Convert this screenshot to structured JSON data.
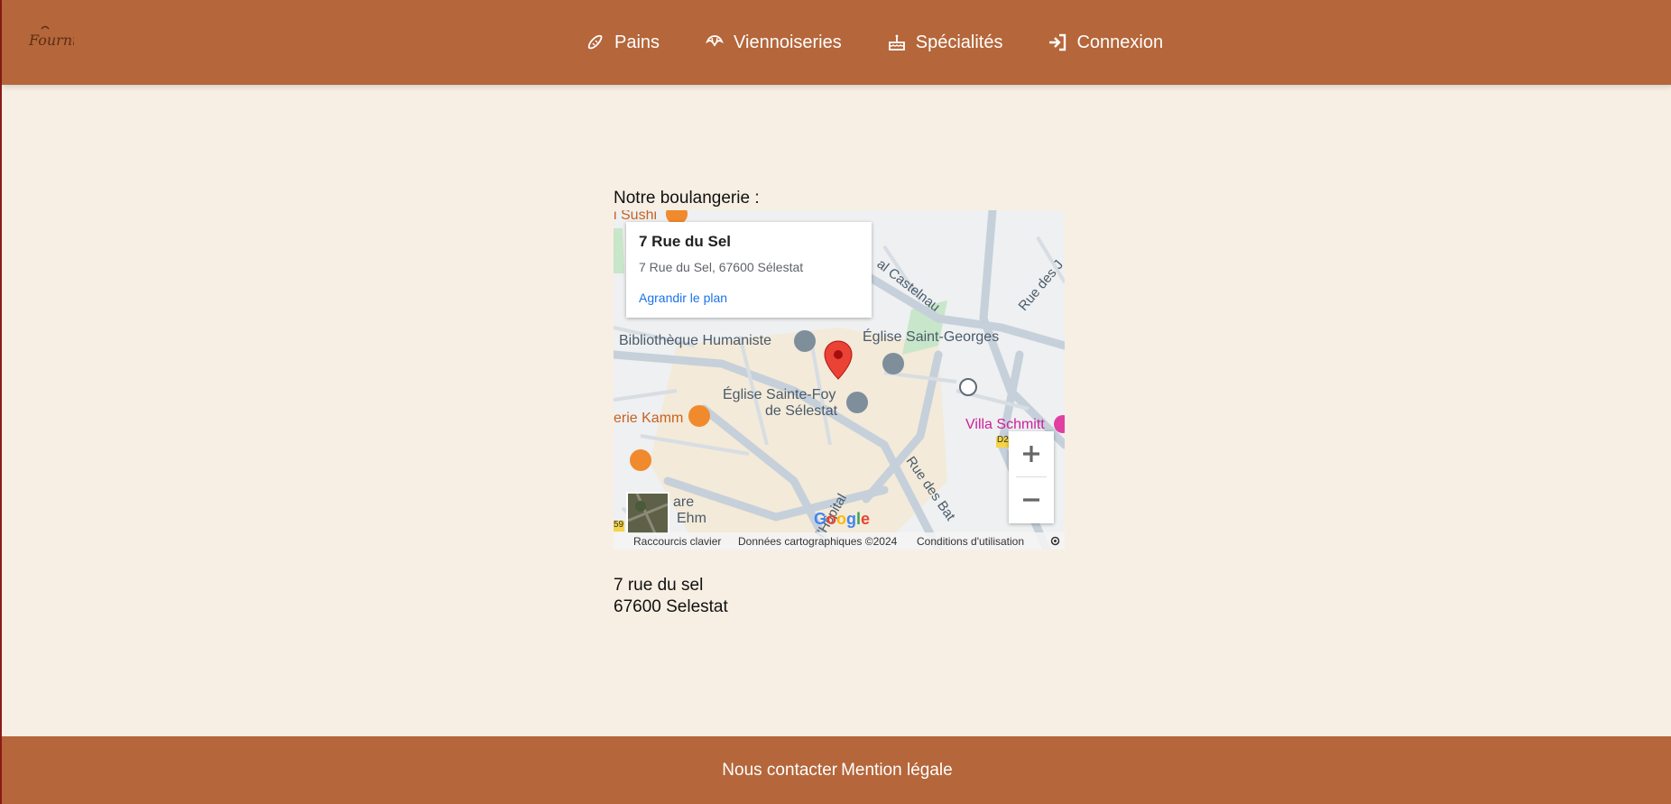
{
  "header": {
    "logo_text": "Fournil",
    "nav": [
      {
        "label": "Pains",
        "icon": "bread-icon"
      },
      {
        "label": "Viennoiseries",
        "icon": "croissant-icon"
      },
      {
        "label": "Spécialités",
        "icon": "cake-icon"
      },
      {
        "label": "Connexion",
        "icon": "login-icon"
      }
    ]
  },
  "main": {
    "title": "Notre boulangerie :",
    "map": {
      "card_title": "7 Rue du Sel",
      "card_address": "7 Rue du Sel, 67600 Sélestat",
      "card_link": "Agrandir le plan",
      "labels": {
        "sushi": "i Sushi",
        "castelnau": "al Castelnau",
        "rue_j": "Rue des J",
        "bibliotheque": "Bibliothèque Humaniste",
        "saint_georges": "Église Saint-Georges",
        "sainte_foy_1": "Église Sainte-Foy",
        "sainte_foy_2": "de Sélestat",
        "kamm": "erie Kamm",
        "villa": "Villa Schmitt",
        "gare_1": "are",
        "gare_2": "Ehm",
        "rue_bat": "Rue des Bat",
        "hopital": "l'Hôpital",
        "route": "D2",
        "route2": "59"
      },
      "google_logo": "Google",
      "attribution": {
        "shortcuts": "Raccourcis clavier",
        "data": "Données cartographiques ©2024",
        "terms": "Conditions d'utilisation"
      }
    },
    "address_line1": "7 rue du sel",
    "address_line2": "67600 Selestat"
  },
  "footer": {
    "contact": "Nous contacter",
    "legal": "Mention légale"
  },
  "colors": {
    "brand": "#b5663a",
    "background": "#f7efe3",
    "link": "#1a73e8",
    "marker": "#ea4335"
  }
}
